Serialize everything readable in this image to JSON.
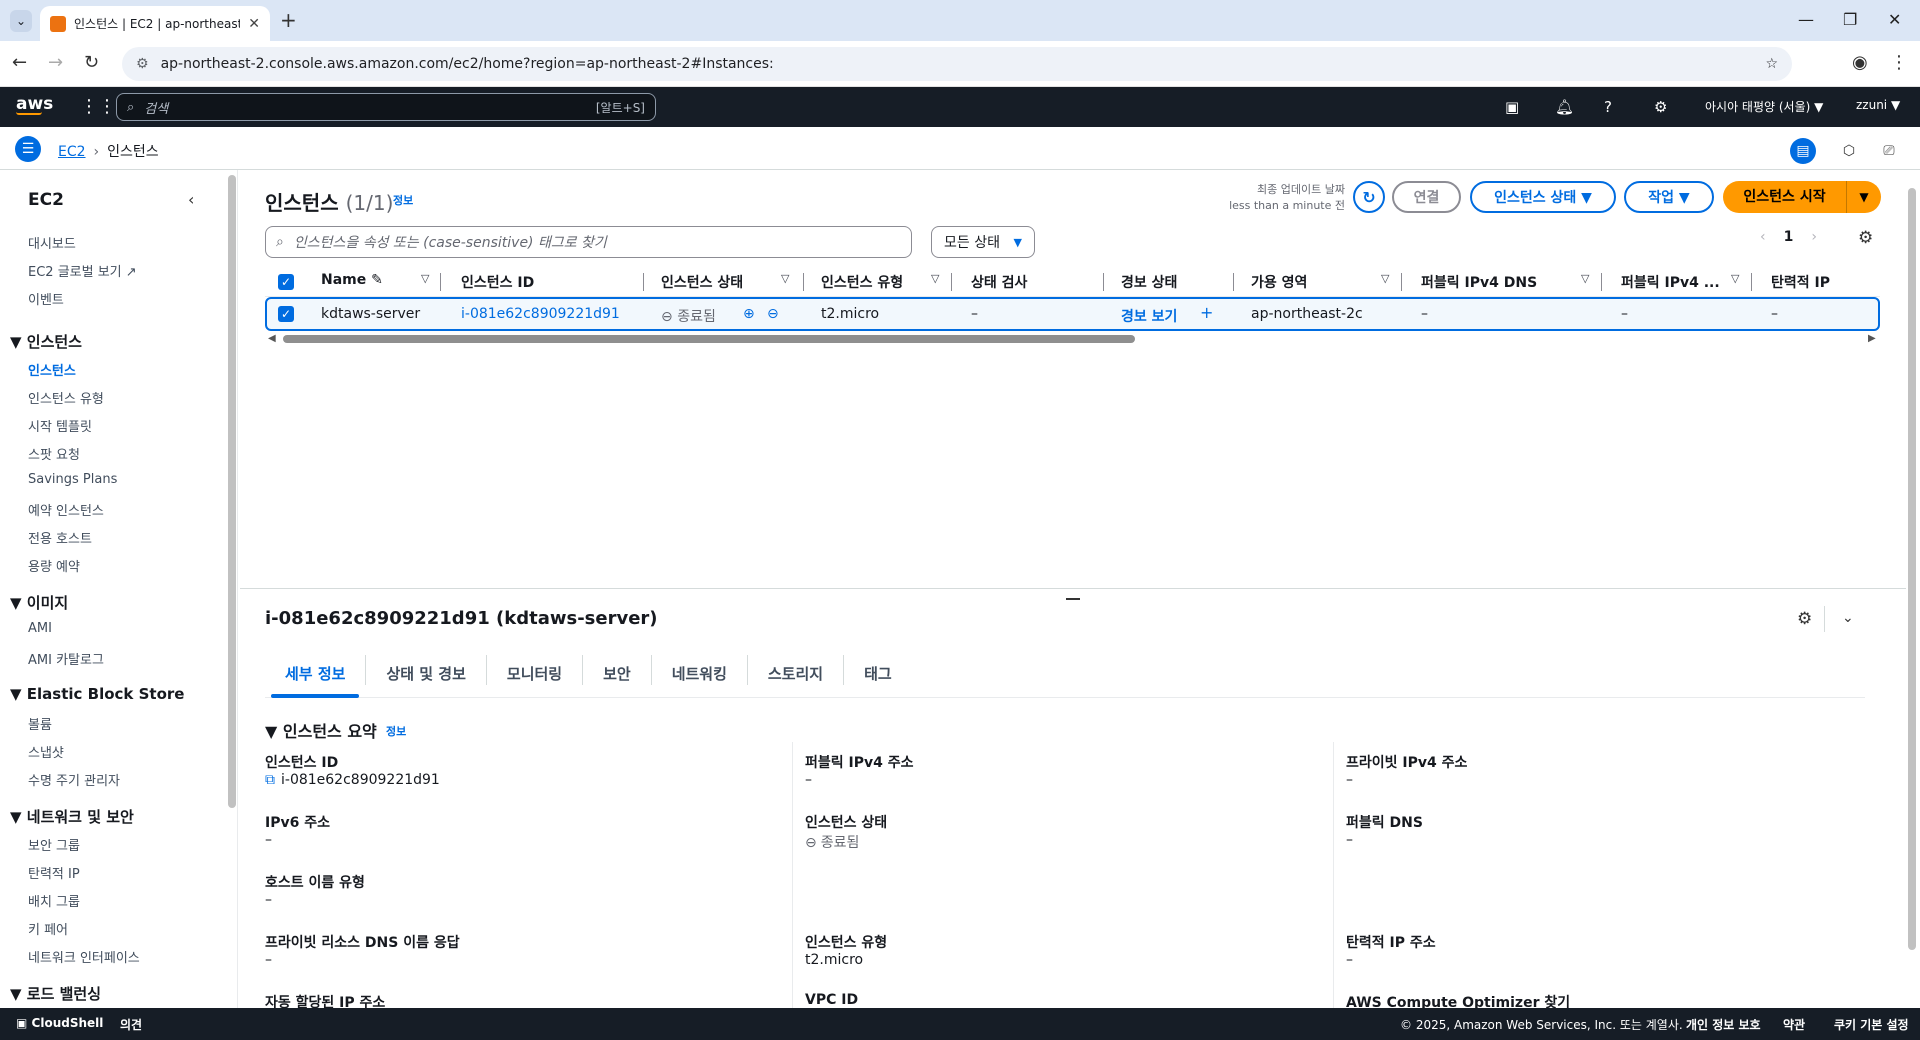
{
  "browser": {
    "tab_title": "인스턴스 | EC2 | ap-northeast-",
    "url": "ap-northeast-2.console.aws.amazon.com/ec2/home?region=ap-northeast-2#Instances:"
  },
  "aws_header": {
    "logo": "aws",
    "search_placeholder": "검색",
    "search_shortcut": "[알트+S]",
    "region": "아시아 태평양 (서울) ▼",
    "user": "zzuni ▼"
  },
  "breadcrumb": {
    "root": "EC2",
    "current": "인스턴스"
  },
  "sidebar": {
    "title": "EC2",
    "top_items": [
      "대시보드",
      "EC2 글로벌 보기 ↗",
      "이벤트"
    ],
    "sections": [
      {
        "header": "인스턴스",
        "items": [
          "인스턴스",
          "인스턴스 유형",
          "시작 템플릿",
          "스팟 요청",
          "Savings Plans",
          "예약 인스턴스",
          "전용 호스트",
          "용량 예약"
        ]
      },
      {
        "header": "이미지",
        "items": [
          "AMI",
          "AMI 카탈로그"
        ]
      },
      {
        "header": "Elastic Block Store",
        "items": [
          "볼륨",
          "스냅샷",
          "수명 주기 관리자"
        ]
      },
      {
        "header": "네트워크 및 보안",
        "items": [
          "보안 그룹",
          "탄력적 IP",
          "배치 그룹",
          "키 페어",
          "네트워크 인터페이스"
        ]
      },
      {
        "header": "로드 밸런싱",
        "items": []
      }
    ],
    "active_item": "인스턴스"
  },
  "list": {
    "title": "인스턴스",
    "count": "(1/1)",
    "info": "정보",
    "last_updated_label": "최종 업데이트 날짜",
    "last_updated_value": "less than a minute 전",
    "connect": "연결",
    "state_btn": "인스턴스 상태 ▼",
    "actions_btn": "작업 ▼",
    "launch_btn": "인스턴스 시작",
    "filter_placeholder": "인스턴스을 속성 또는 (case-sensitive) 태그로 찾기",
    "state_filter": "모든 상태",
    "page": "1"
  },
  "table": {
    "columns": [
      "Name ✎",
      "인스턴스 ID",
      "인스턴스 상태",
      "인스턴스 유형",
      "상태 검사",
      "경보 상태",
      "가용 영역",
      "퍼블릭 IPv4 DNS",
      "퍼블릭 IPv4 ...",
      "탄력적 IP"
    ],
    "row": {
      "name": "kdtaws-server",
      "id": "i-081e62c8909221d91",
      "state": "종료됨",
      "type": "t2.micro",
      "check": "–",
      "alarm": "경보 보기",
      "az": "ap-northeast-2c",
      "dns": "–",
      "ipv4": "–",
      "eip": "–"
    }
  },
  "detail": {
    "title": "i-081e62c8909221d91 (kdtaws-server)",
    "tabs": [
      "세부 정보",
      "상태 및 경보",
      "모니터링",
      "보안",
      "네트워킹",
      "스토리지",
      "태그"
    ],
    "summary_header": "인스턴스 요약",
    "summary_info": "정보",
    "fields": {
      "c1": [
        {
          "label": "인스턴스 ID",
          "value": "i-081e62c8909221d91"
        },
        {
          "label": "IPv6 주소",
          "value": "–"
        },
        {
          "label": "호스트 이름 유형",
          "value": "–"
        },
        {
          "label": "프라이빗 리소스 DNS 이름 응답",
          "value": "–"
        },
        {
          "label": "자동 할당된 IP 주소",
          "value": ""
        }
      ],
      "c2": [
        {
          "label": "퍼블릭 IPv4 주소",
          "value": "–"
        },
        {
          "label": "인스턴스 상태",
          "value": "종료됨"
        },
        {
          "label": "인스턴스 유형",
          "value": "t2.micro"
        },
        {
          "label": "VPC ID",
          "value": ""
        }
      ],
      "c3": [
        {
          "label": "프라이빗 IPv4 주소",
          "value": "–"
        },
        {
          "label": "퍼블릭 DNS",
          "value": "–"
        },
        {
          "label": "탄력적 IP 주소",
          "value": "–"
        },
        {
          "label": "AWS Compute Optimizer 찾기",
          "value": ""
        }
      ]
    }
  },
  "footer": {
    "cloudshell": "CloudShell",
    "feedback": "의견",
    "copyright": "© 2025, Amazon Web Services, Inc. 또는 계열사.",
    "privacy": "개인 정보 보호",
    "terms": "약관",
    "cookies": "쿠키 기본 설정"
  }
}
